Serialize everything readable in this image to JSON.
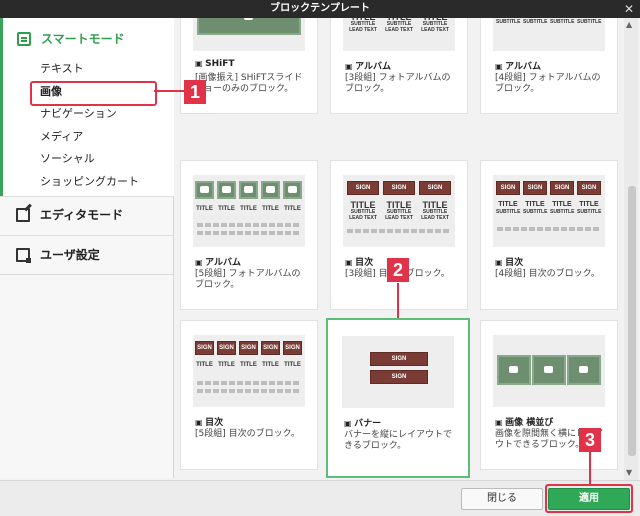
{
  "window": {
    "title": "ブロックテンプレート",
    "close_glyph": "✕"
  },
  "sidebar": {
    "smart_mode": "スマートモード",
    "items": [
      "テキスト",
      "画像",
      "ナビゲーション",
      "メディア",
      "ソーシャル",
      "ショッピングカート"
    ],
    "selected": "画像",
    "editor_mode": "エディタモード",
    "user_settings": "ユーザ設定"
  },
  "callouts": [
    "1",
    "2",
    "3"
  ],
  "cards": [
    {
      "title": "SHiFT",
      "desc": "[画像振え] SHiFTスライドショーのみのブロック。"
    },
    {
      "title": "アルバム",
      "desc": "[3段組] フォトアルバムのブロック。"
    },
    {
      "title": "アルバム",
      "desc": "[4段組] フォトアルバムのブロック。"
    },
    {
      "title": "アルバム",
      "desc": "[5段組] フォトアルバムのブロック。"
    },
    {
      "title": "目次",
      "desc": "[3段組] 目次のブロック。"
    },
    {
      "title": "目次",
      "desc": "[4段組] 目次のブロック。"
    },
    {
      "title": "目次",
      "desc": "[5段組] 目次のブロック。"
    },
    {
      "title": "バナー",
      "desc": "バナーを縦にレイアウトできるブロック。"
    },
    {
      "title": "画像 横並び",
      "desc": "画像を隙間無く横にレイアウトできるブロック。"
    }
  ],
  "thumb_text": {
    "title": "TITLE",
    "subtitle": "SUBTITLE",
    "lead": "LEAD TEXT",
    "sign": "SIGN"
  },
  "footer": {
    "close_label": "閉じる",
    "apply_label": "適用"
  },
  "colors": {
    "accent_green": "#2fa957",
    "callout_red": "#e0334a",
    "sign_brown": "#7a3c34",
    "photo_green": "#6e8f6f"
  }
}
